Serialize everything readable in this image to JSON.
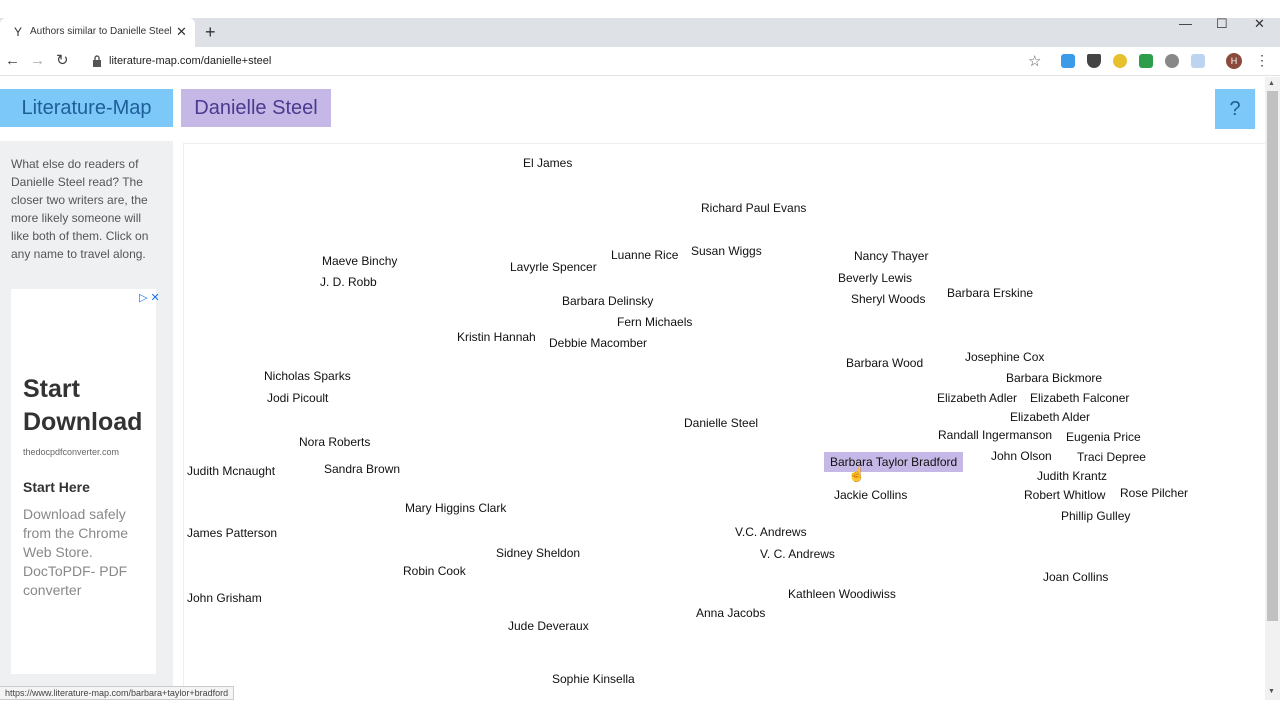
{
  "browser": {
    "tab_title": "Authors similar to Danielle Steel",
    "url": "literature-map.com/danielle+steel",
    "avatar_letter": "H",
    "status_url": "https://www.literature-map.com/barbara+taylor+bradford"
  },
  "site": {
    "logo": "Literature-Map",
    "author": "Danielle Steel",
    "help": "?",
    "intro": "What else do readers of Danielle Steel read? The closer two writers are, the more likely someone will like both of them. Click on any name to travel along."
  },
  "ad": {
    "title": "Start Download",
    "domain": "thedocpdfconverter.com",
    "subtitle": "Start Here",
    "description": "Download safely from the Chrome Web Store. DocToPDF- PDF converter"
  },
  "map": {
    "highlighted": "Barbara Taylor Bradford",
    "authors": [
      "El James",
      "Richard Paul Evans",
      "Maeve Binchy",
      "J. D. Robb",
      "Lavyrle Spencer",
      "Luanne Rice",
      "Susan Wiggs",
      "Nancy Thayer",
      "Beverly Lewis",
      "Sheryl Woods",
      "Barbara Erskine",
      "Barbara Delinsky",
      "Fern Michaels",
      "Kristin Hannah",
      "Debbie Macomber",
      "Barbara Wood",
      "Josephine Cox",
      "Nicholas Sparks",
      "Barbara Bickmore",
      "Jodi Picoult",
      "Elizabeth Adler",
      "Elizabeth Falconer",
      "Elizabeth Alder",
      "Danielle Steel",
      "Randall Ingermanson",
      "Eugenia Price",
      "Nora Roberts",
      "John Olson",
      "Traci Depree",
      "Barbara Taylor Bradford",
      "Judith Mcnaught",
      "Sandra Brown",
      "Judith Krantz",
      "Jackie Collins",
      "Robert Whitlow",
      "Rose Pilcher",
      "Mary Higgins Clark",
      "Phillip Gulley",
      "James Patterson",
      "V.C. Andrews",
      "Sidney Sheldon",
      "V. C. Andrews",
      "Robin Cook",
      "Joan Collins",
      "John Grisham",
      "Kathleen Woodiwiss",
      "Anna Jacobs",
      "Jude Deveraux",
      "Sophie Kinsella"
    ]
  }
}
